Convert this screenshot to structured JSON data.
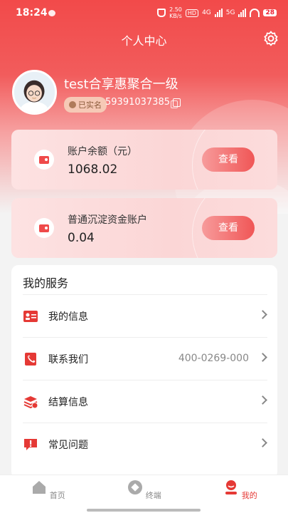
{
  "status": {
    "time": "18:24",
    "speed": "2.50\nKB/s",
    "hd": "HD",
    "net1": "4G",
    "net2": "5G",
    "battery": "28"
  },
  "header": {
    "title": "个人中心"
  },
  "profile": {
    "name": "test合享惠聚合一级",
    "badge": "已实名",
    "phone": "59391037385"
  },
  "cards": [
    {
      "label": "账户余额（元）",
      "value": "1068.02",
      "button": "查看"
    },
    {
      "label": "普通沉淀资金账户",
      "value": "0.04",
      "button": "查看"
    }
  ],
  "services": {
    "title": "我的服务",
    "items": [
      {
        "label": "我的信息",
        "extra": ""
      },
      {
        "label": "联系我们",
        "extra": "400-0269-000"
      },
      {
        "label": "结算信息",
        "extra": ""
      },
      {
        "label": "常见问题",
        "extra": ""
      }
    ]
  },
  "tabs": [
    {
      "label": "首页"
    },
    {
      "label": "终端"
    },
    {
      "label": "我的"
    }
  ],
  "colors": {
    "brand": "#ef4444",
    "accent": "#e53935"
  }
}
